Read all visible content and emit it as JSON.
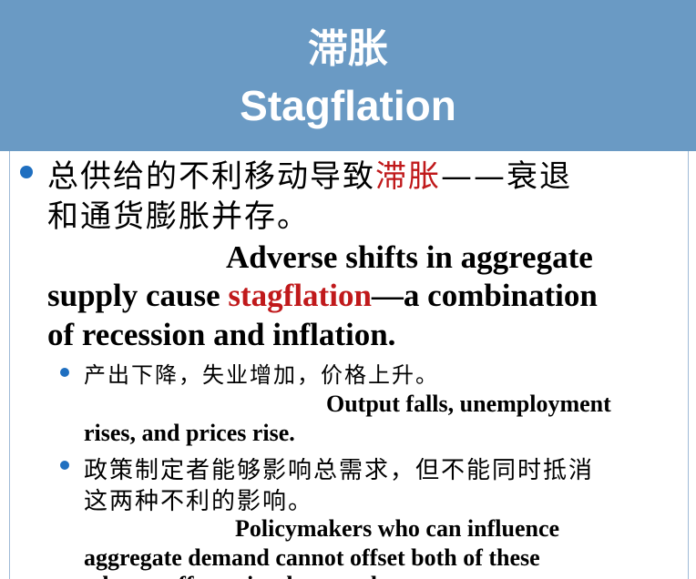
{
  "title": {
    "chinese": "滞胀",
    "english": "Stagflation"
  },
  "colors": {
    "title_bar": "#6a9ac4",
    "title_text": "#ffffff",
    "bullet": "#1f6fc0",
    "highlight": "#c0191b",
    "body_text": "#000000"
  },
  "main_bullet": {
    "cn_line1_before": "总供给的不利移动导致",
    "cn_line1_highlight": "滞胀",
    "cn_line1_after": "——衰退",
    "cn_line2": "和通货膨胀并存。",
    "en_line1": "Adverse shifts in aggregate",
    "en_line2_before": "supply cause ",
    "en_line2_highlight": "stagflation",
    "en_line2_after": "—a combination",
    "en_line3": "of recession and inflation."
  },
  "sub_bullets": [
    {
      "cn_line1": "产出下降，失业增加，价格上升。",
      "en_line1": "Output falls, unemployment",
      "en_line2": "rises, and prices rise."
    },
    {
      "cn_line1": "政策制定者能够影响总需求，但不能同时抵消",
      "cn_line2": "这两种不利的影响。",
      "en_line1": "Policymakers who can influence",
      "en_line2": "aggregate demand cannot offset both of these",
      "en_line3": "adverse effects simultaneously."
    }
  ]
}
